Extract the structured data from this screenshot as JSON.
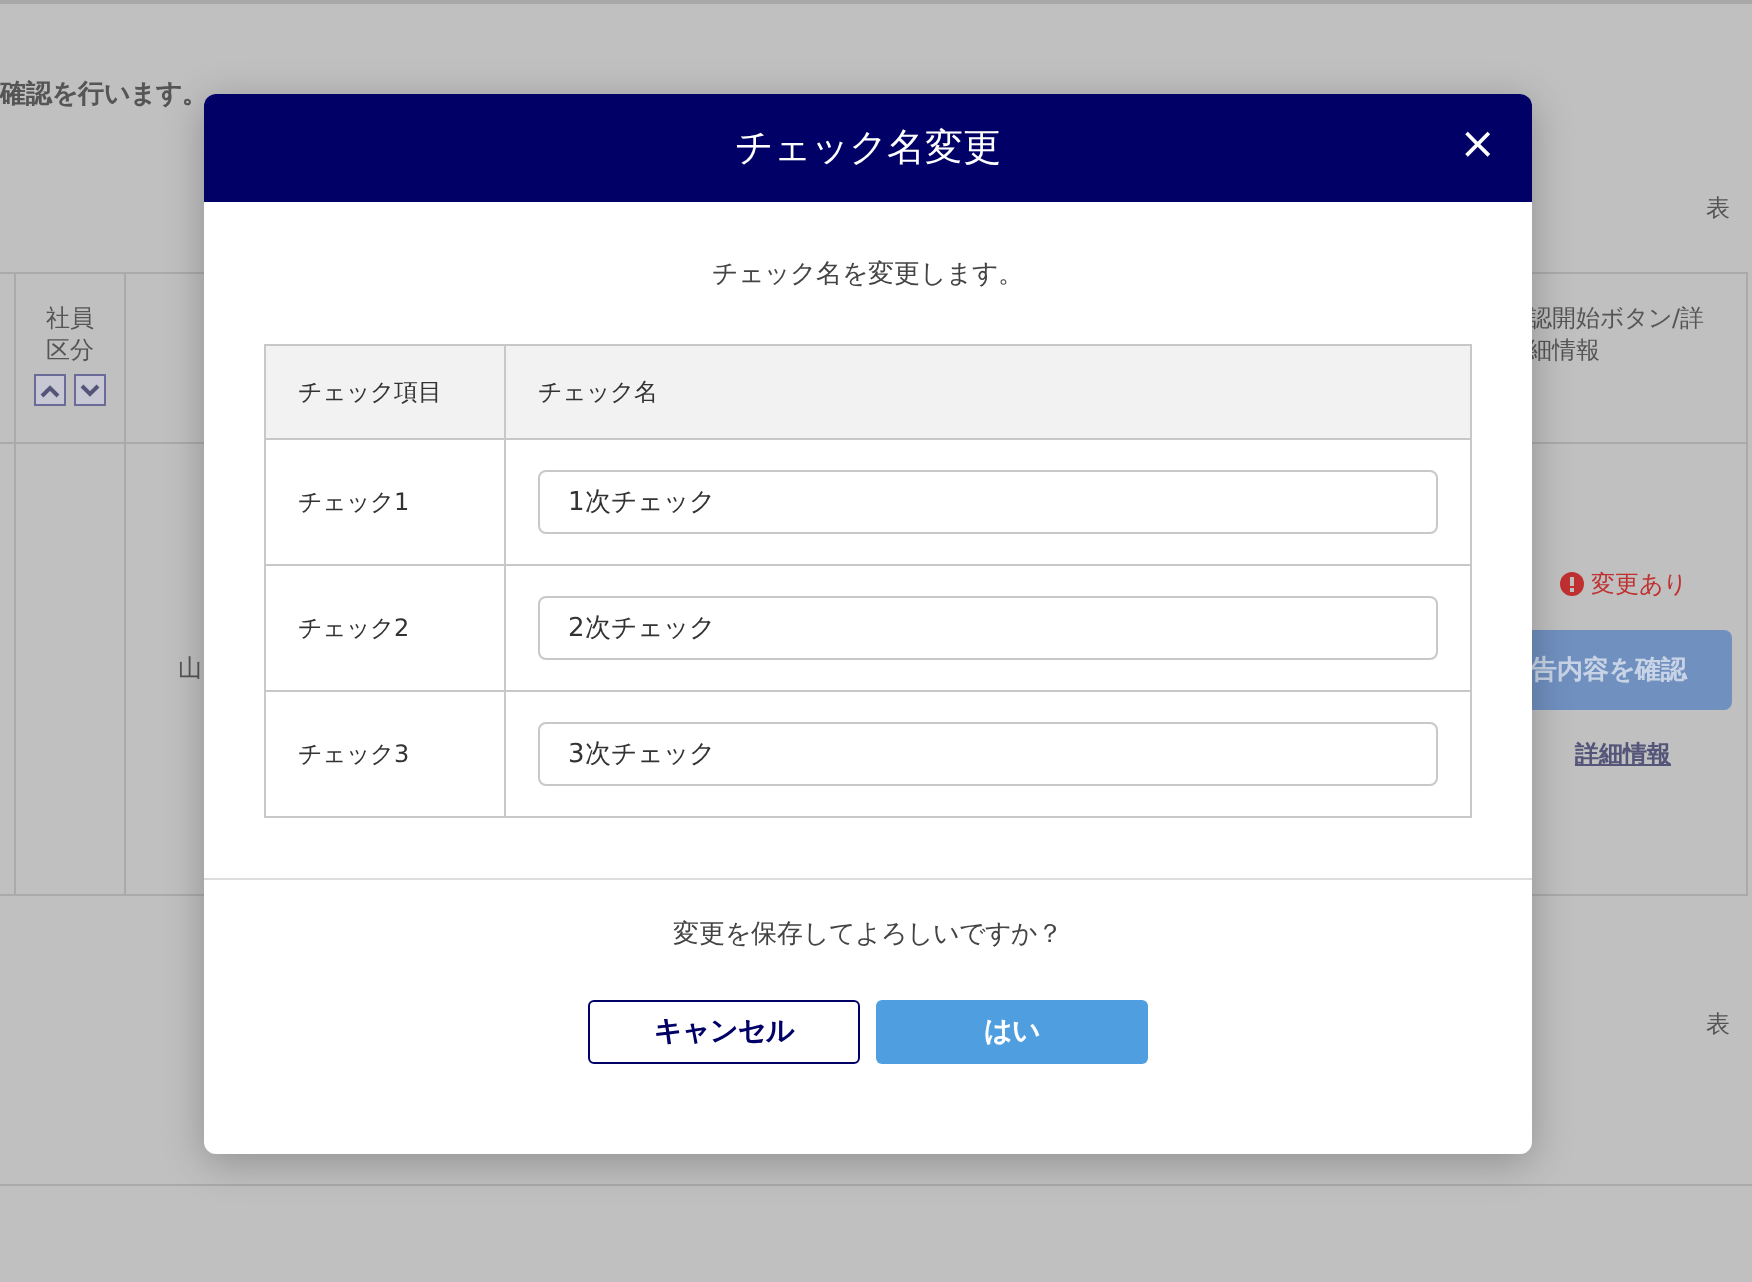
{
  "background": {
    "notice": "確認を行います。",
    "display_label_top": "表",
    "table": {
      "columns": [
        {
          "label": "社員区分"
        },
        {
          "label": "認開始ボタン/詳細情報"
        }
      ],
      "row": {
        "name": "山",
        "status": "変更あり",
        "confirm_button": "告内容を確認",
        "details_link": "詳細情報"
      }
    },
    "display_label_bottom": "表"
  },
  "dialog": {
    "title": "チェック名変更",
    "close": "×",
    "message": "チェック名を変更します。",
    "columns": [
      "チェック項目",
      "チェック名"
    ],
    "rows": [
      {
        "item": "チェック1",
        "name": "1次チェック"
      },
      {
        "item": "チェック2",
        "name": "2次チェック"
      },
      {
        "item": "チェック3",
        "name": "3次チェック"
      }
    ],
    "question": "変更を保存してよろしいですか？",
    "buttons": [
      {
        "kind": "secondary",
        "label": "キャンセル"
      },
      {
        "kind": "primary",
        "label": "はい"
      }
    ]
  }
}
